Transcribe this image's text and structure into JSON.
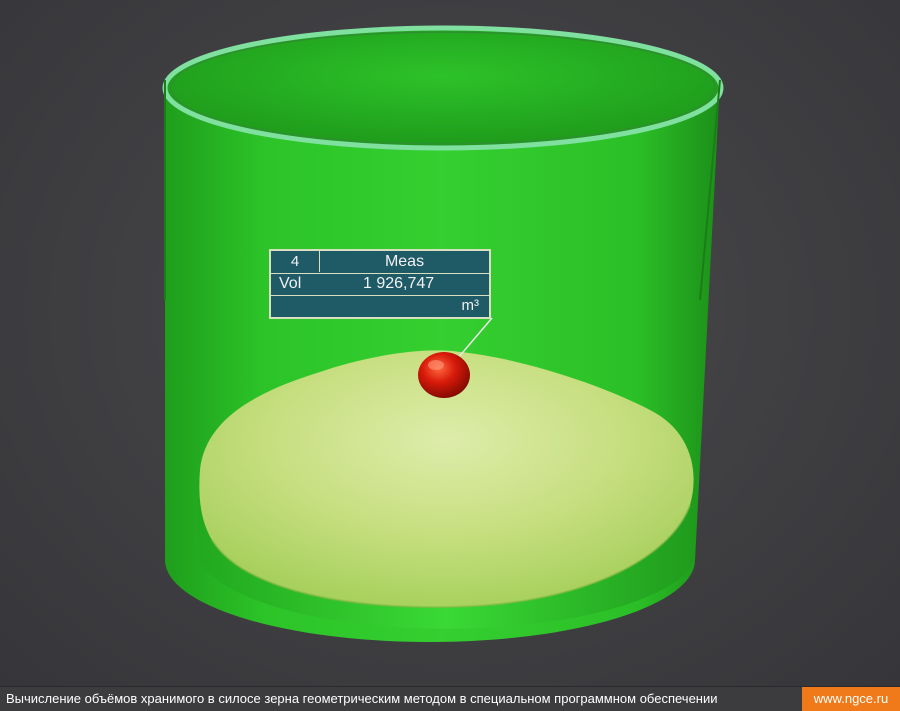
{
  "measurement_label": {
    "id": "4",
    "title": "Meas",
    "key": "Vol",
    "value": "1 926,747",
    "unit": "m³"
  },
  "caption": {
    "text": "Вычисление объёмов хранимого в силосе зерна геометрическим методом в специальном программном обеспечении",
    "site": "www.ngce.ru"
  },
  "colors": {
    "background": "#3f3f42",
    "silo": "#2ec42a",
    "grain": "#c9e07a",
    "marker": "#d81a0a",
    "label_bg": "#1f5a67",
    "badge": "#f07a1a"
  },
  "icons": {
    "marker": "measure-point-sphere-icon"
  }
}
